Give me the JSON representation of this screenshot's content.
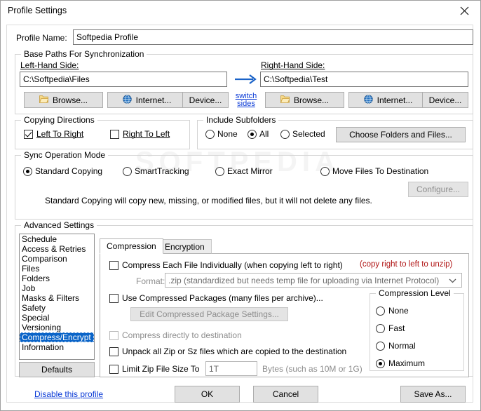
{
  "window": {
    "title": "Profile Settings",
    "close_icon": "close-icon"
  },
  "profile": {
    "name_label": "Profile Name:",
    "name_value": "Softpedia Profile"
  },
  "base_paths": {
    "legend": "Base Paths For Synchronization",
    "left_label": "Left-Hand Side:",
    "left_value": "C:\\Softpedia\\Files",
    "right_label": "Right-Hand Side:",
    "right_value": "C:\\Softpedia\\Test",
    "arrow_icon": "right-arrow-icon",
    "switch_sides_line1": "switch",
    "switch_sides_line2": "sides",
    "left_buttons": [
      {
        "label": "Browse...",
        "icon": "folder-icon"
      },
      {
        "label": "Internet...",
        "icon": "globe-icon"
      },
      {
        "label": "Device...",
        "icon": "none"
      }
    ],
    "right_buttons": [
      {
        "label": "Browse...",
        "icon": "folder-icon"
      },
      {
        "label": "Internet...",
        "icon": "globe-icon"
      },
      {
        "label": "Device...",
        "icon": "none"
      }
    ]
  },
  "copying_directions": {
    "legend": "Copying Directions",
    "left_to_right": {
      "label": "Left To Right",
      "checked": true
    },
    "right_to_left": {
      "label": "Right To Left",
      "checked": false
    }
  },
  "include_subfolders": {
    "legend": "Include Subfolders",
    "options": [
      {
        "label": "None",
        "selected": false
      },
      {
        "label": "All",
        "selected": true
      },
      {
        "label": "Selected",
        "selected": false
      }
    ],
    "choose_button": "Choose Folders and Files..."
  },
  "sync_mode": {
    "legend": "Sync Operation Mode",
    "options": [
      {
        "label": "Standard Copying",
        "selected": true
      },
      {
        "label": "SmartTracking",
        "selected": false
      },
      {
        "label": "Exact Mirror",
        "selected": false
      },
      {
        "label": "Move Files To Destination",
        "selected": false
      }
    ],
    "configure_button": "Configure...",
    "description": "Standard Copying will copy new, missing, or modified files, but it will not delete any files."
  },
  "advanced": {
    "legend": "Advanced Settings",
    "items": [
      "Schedule",
      "Access & Retries",
      "Comparison",
      "Files",
      "Folders",
      "Job",
      "Masks & Filters",
      "Safety",
      "Special",
      "Versioning",
      "Compress/Encrypt",
      "Information"
    ],
    "selected_index": 10,
    "defaults_button": "Defaults"
  },
  "tabs": [
    {
      "label": "Compression",
      "active": true
    },
    {
      "label": "Encryption",
      "active": false
    }
  ],
  "compression": {
    "compress_each_file": {
      "label": "Compress Each File Individually (when copying left to right)",
      "checked": false
    },
    "note_right": "(copy right to left to unzip)",
    "format_label": "Format:",
    "format_value": ".zip (standardized but needs temp file for uploading via Internet Protocol)",
    "format_arrow_icon": "chevron-down-icon",
    "use_packages": {
      "label": "Use Compressed Packages (many files per archive)...",
      "checked": false
    },
    "edit_package_button": "Edit Compressed Package Settings...",
    "compress_direct": {
      "label": "Compress directly to destination",
      "checked": false,
      "disabled": true
    },
    "unpack_all": {
      "label": "Unpack all Zip or Sz files which are copied to the destination",
      "checked": false
    },
    "limit_zip": {
      "label": "Limit Zip File Size To",
      "checked": false,
      "value": "1T",
      "suffix": "Bytes (such as 10M or 1G)"
    },
    "level": {
      "legend": "Compression Level",
      "options": [
        {
          "label": "None",
          "selected": false
        },
        {
          "label": "Fast",
          "selected": false
        },
        {
          "label": "Normal",
          "selected": false
        },
        {
          "label": "Maximum",
          "selected": true
        }
      ]
    }
  },
  "footer": {
    "disable_link": "Disable this profile",
    "ok_button": "OK",
    "cancel_button": "Cancel",
    "save_as_button": "Save As..."
  },
  "watermark": "SOFTPEDIA",
  "colors": {
    "accent": "#0a64c8",
    "link": "#0a3ad6",
    "note_red": "#b01515",
    "button_face": "#e1e1e1"
  }
}
